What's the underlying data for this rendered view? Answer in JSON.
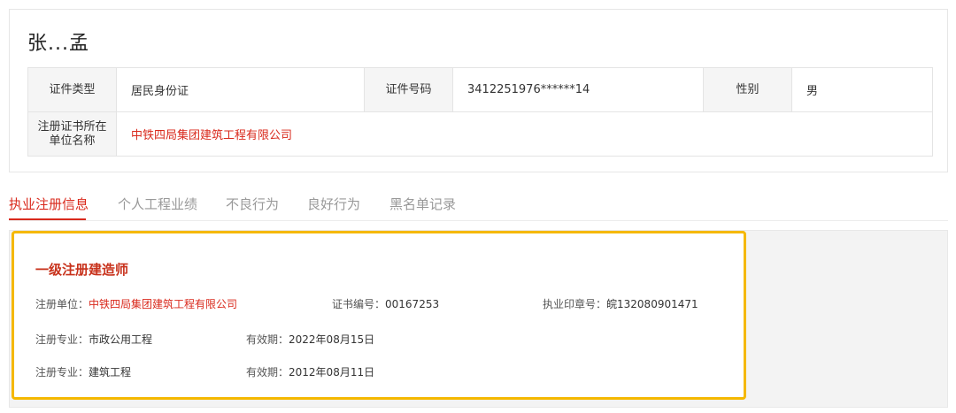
{
  "person": {
    "name": "张...孟"
  },
  "info": {
    "id_type_label": "证件类型",
    "id_type_value": "居民身份证",
    "id_number_label": "证件号码",
    "id_number_value": "3412251976******14",
    "gender_label": "性别",
    "gender_value": "男",
    "unit_label": "注册证书所在单位名称",
    "unit_value": "中铁四局集团建筑工程有限公司"
  },
  "tabs": [
    {
      "label": "执业注册信息",
      "active": true
    },
    {
      "label": "个人工程业绩",
      "active": false
    },
    {
      "label": "不良行为",
      "active": false
    },
    {
      "label": "良好行为",
      "active": false
    },
    {
      "label": "黑名单记录",
      "active": false
    }
  ],
  "certificate": {
    "title": "一级注册建造师",
    "unit_label": "注册单位：",
    "unit_value": "中铁四局集团建筑工程有限公司",
    "cert_no_label": "证书编号：",
    "cert_no_value": "00167253",
    "seal_no_label": "执业印章号：",
    "seal_no_value": "皖132080901471",
    "specialties": [
      {
        "label": "注册专业：",
        "value": "市政公用工程",
        "validity_label": "有效期：",
        "validity_value": "2022年08月15日"
      },
      {
        "label": "注册专业：",
        "value": "建筑工程",
        "validity_label": "有效期：",
        "validity_value": "2012年08月11日"
      }
    ]
  },
  "colors": {
    "accent": "#d9291c",
    "highlight_border": "#f5b800"
  }
}
